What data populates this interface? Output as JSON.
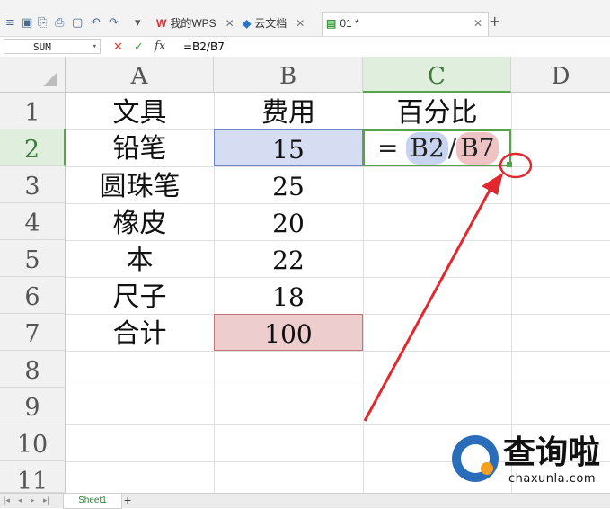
{
  "toolbar": {
    "tabs": [
      {
        "label": "我的WPS",
        "icon": "wps-icon"
      },
      {
        "label": "云文档",
        "icon": "cloud-doc-icon"
      },
      {
        "label": "01 *",
        "icon": "sheet-file-icon"
      }
    ],
    "add_tab": "+"
  },
  "formula_bar": {
    "name_box": "SUM",
    "cancel": "✕",
    "confirm": "✓",
    "fx": "fx",
    "formula": "=B2/B7"
  },
  "columns": [
    "A",
    "B",
    "C",
    "D"
  ],
  "rows": [
    "1",
    "2",
    "3",
    "4",
    "5",
    "6",
    "7",
    "8",
    "9",
    "10",
    "11"
  ],
  "table": {
    "header": {
      "a": "文具",
      "b": "费用",
      "c": "百分比"
    },
    "items": [
      {
        "a": "铅笔",
        "b": "15"
      },
      {
        "a": "圆珠笔",
        "b": "25"
      },
      {
        "a": "橡皮",
        "b": "20"
      },
      {
        "a": "本",
        "b": "22"
      },
      {
        "a": "尺子",
        "b": "18"
      },
      {
        "a": "合计",
        "b": "100"
      }
    ]
  },
  "cell_formula": {
    "eq": "=",
    "ref1": "B2",
    "op": "/",
    "ref2": "B7"
  },
  "sheet_tabs": [
    "Sheet1"
  ],
  "annotation_color": "#e0282e",
  "watermark": {
    "text": "查询啦",
    "url": "chaxunla.com"
  }
}
